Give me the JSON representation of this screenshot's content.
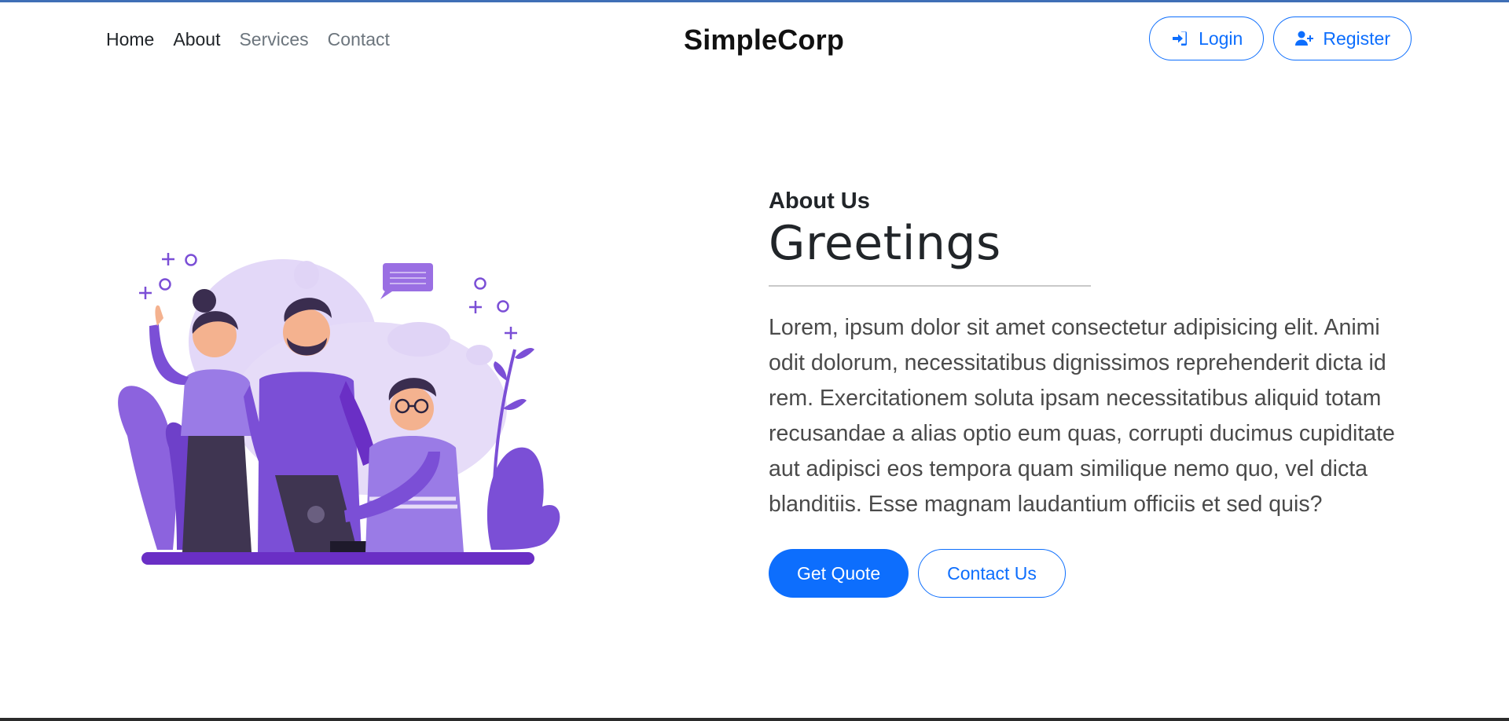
{
  "brand": "SimpleCorp",
  "nav": {
    "items": [
      {
        "label": "Home"
      },
      {
        "label": "About"
      },
      {
        "label": "Services"
      },
      {
        "label": "Contact"
      }
    ]
  },
  "auth": {
    "login_label": "Login",
    "login_icon": "sign-in-icon",
    "register_label": "Register",
    "register_icon": "user-plus-icon"
  },
  "hero": {
    "eyebrow": "About Us",
    "title": "Greetings",
    "body": "Lorem, ipsum dolor sit amet consectetur adipisicing elit. Animi odit dolorum, necessitatibus dignissimos reprehenderit dicta id rem. Exercitationem soluta ipsam necessitatibus aliquid totam recusandae a alias optio eum quas, corrupti ducimus cupiditate aut adipisci eos tempora quam similique nemo quo, vel dicta blanditiis. Esse magnam laudantium officiis et sed quis?",
    "primary_cta": "Get Quote",
    "secondary_cta": "Contact Us"
  },
  "colors": {
    "accent": "#0d6efd",
    "illustration_purple": "#7b4fd6",
    "illustration_light": "#e3d8f8"
  }
}
